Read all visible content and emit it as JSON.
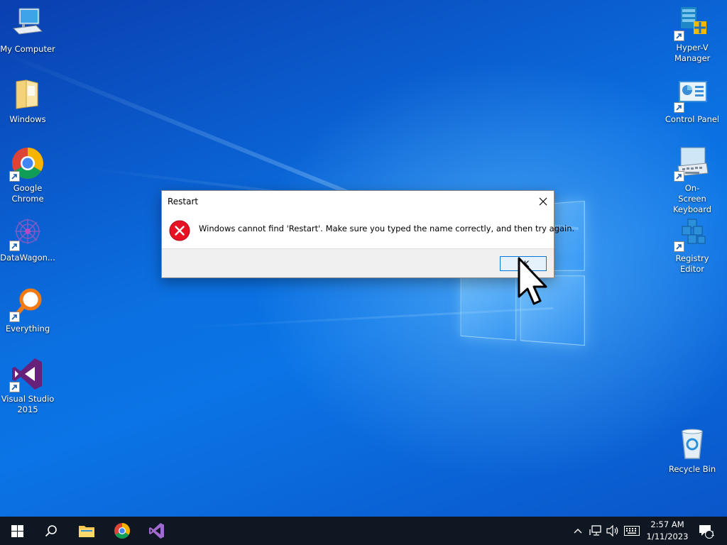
{
  "desktop": {
    "left_icons": [
      {
        "label": "My Computer",
        "icon": "computer-icon"
      },
      {
        "label": "Windows",
        "icon": "folder-icon"
      },
      {
        "label": "Google Chrome",
        "icon": "chrome-icon"
      },
      {
        "label": "DataWagon...",
        "icon": "datawagon-icon"
      },
      {
        "label": "Everything",
        "icon": "everything-icon"
      },
      {
        "label": "Visual Studio 2015",
        "icon": "visual-studio-icon"
      }
    ],
    "right_icons": [
      {
        "label": "Hyper-V Manager",
        "icon": "hyper-v-icon"
      },
      {
        "label": "Control Panel",
        "icon": "control-panel-icon"
      },
      {
        "label": "On-Screen Keyboard",
        "icon": "keyboard-icon"
      },
      {
        "label": "Registry Editor",
        "icon": "registry-editor-icon"
      },
      {
        "label": "Recycle Bin",
        "icon": "recycle-bin-icon"
      }
    ]
  },
  "dialog": {
    "title": "Restart",
    "message": "Windows cannot find 'Restart'. Make sure you typed the name correctly, and then try again.",
    "ok_label": "OK"
  },
  "taskbar": {
    "pinned": [
      "start-icon",
      "search-icon",
      "file-explorer-icon",
      "chrome-icon",
      "visual-studio-icon"
    ],
    "clock_time": "2:57 AM",
    "clock_date": "1/11/2023",
    "notification_count": "1"
  },
  "colors": {
    "accent": "#0078d7",
    "error_red": "#e81123",
    "taskbar_bg": "#0f1722"
  }
}
